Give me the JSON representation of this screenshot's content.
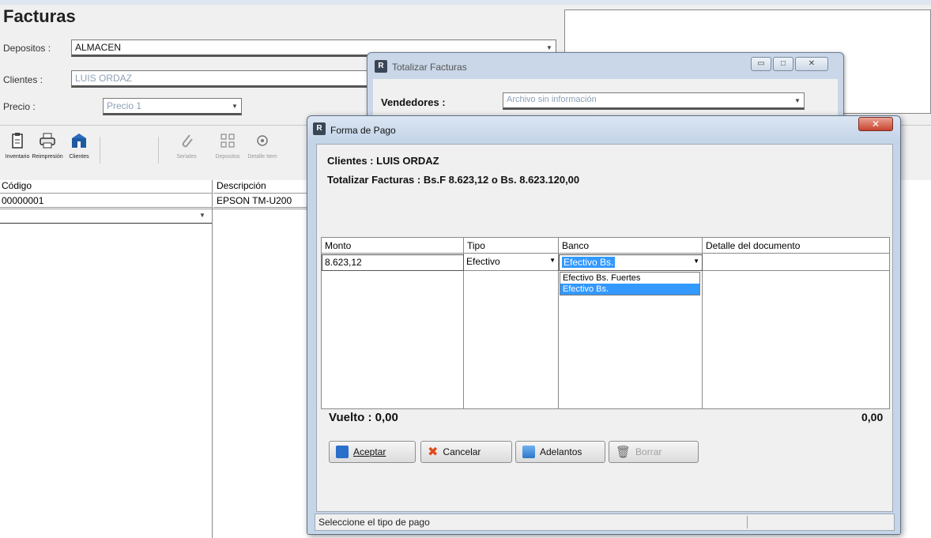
{
  "main": {
    "title": "Facturas",
    "depositos_label": "Depositos :",
    "depositos_value": "ALMACEN",
    "clientes_label": "Clientes :",
    "clientes_value": "LUIS ORDAZ",
    "precio_label": "Precio :",
    "precio_value": "Precio 1"
  },
  "toolbar": {
    "items": [
      {
        "label": "Inventario",
        "icon": "clipboard-icon",
        "enabled": true
      },
      {
        "label": "Reimpresión",
        "icon": "printer-icon",
        "enabled": true
      },
      {
        "label": "Clientes",
        "icon": "clients-icon",
        "enabled": true
      },
      {
        "label": "Seriales",
        "icon": "paperclip-icon",
        "enabled": false
      },
      {
        "label": "Depositos",
        "icon": "deposits-icon",
        "enabled": false
      },
      {
        "label": "Detalle Item",
        "icon": "detail-icon",
        "enabled": false
      }
    ]
  },
  "grid": {
    "headers": [
      "Código",
      "Descripción"
    ],
    "rows": [
      [
        "00000001",
        "EPSON TM-U200"
      ]
    ]
  },
  "totalizar": {
    "title": "Totalizar Facturas",
    "vendedores_label": "Vendedores :",
    "vendedores_value": "Archivo sin información"
  },
  "forma_pago": {
    "title": "Forma de Pago",
    "clientes_line": "Clientes : LUIS ORDAZ",
    "totalizar_line": "Totalizar Facturas : Bs.F 8.623,12 o Bs. 8.623.120,00",
    "columns": [
      "Monto",
      "Tipo",
      "Banco",
      "Detalle del documento"
    ],
    "row": {
      "monto": "8.623,12",
      "tipo": "Efectivo",
      "banco": "Efectivo Bs."
    },
    "banco_options": [
      "Efectivo Bs. Fuertes",
      "Efectivo Bs."
    ],
    "vuelto": "Vuelto : 0,00",
    "total_right": "0,00",
    "buttons": {
      "aceptar": "Aceptar",
      "cancelar": "Cancelar",
      "adelantos": "Adelantos",
      "borrar": "Borrar"
    },
    "status": "Seleccione el tipo de pago"
  }
}
